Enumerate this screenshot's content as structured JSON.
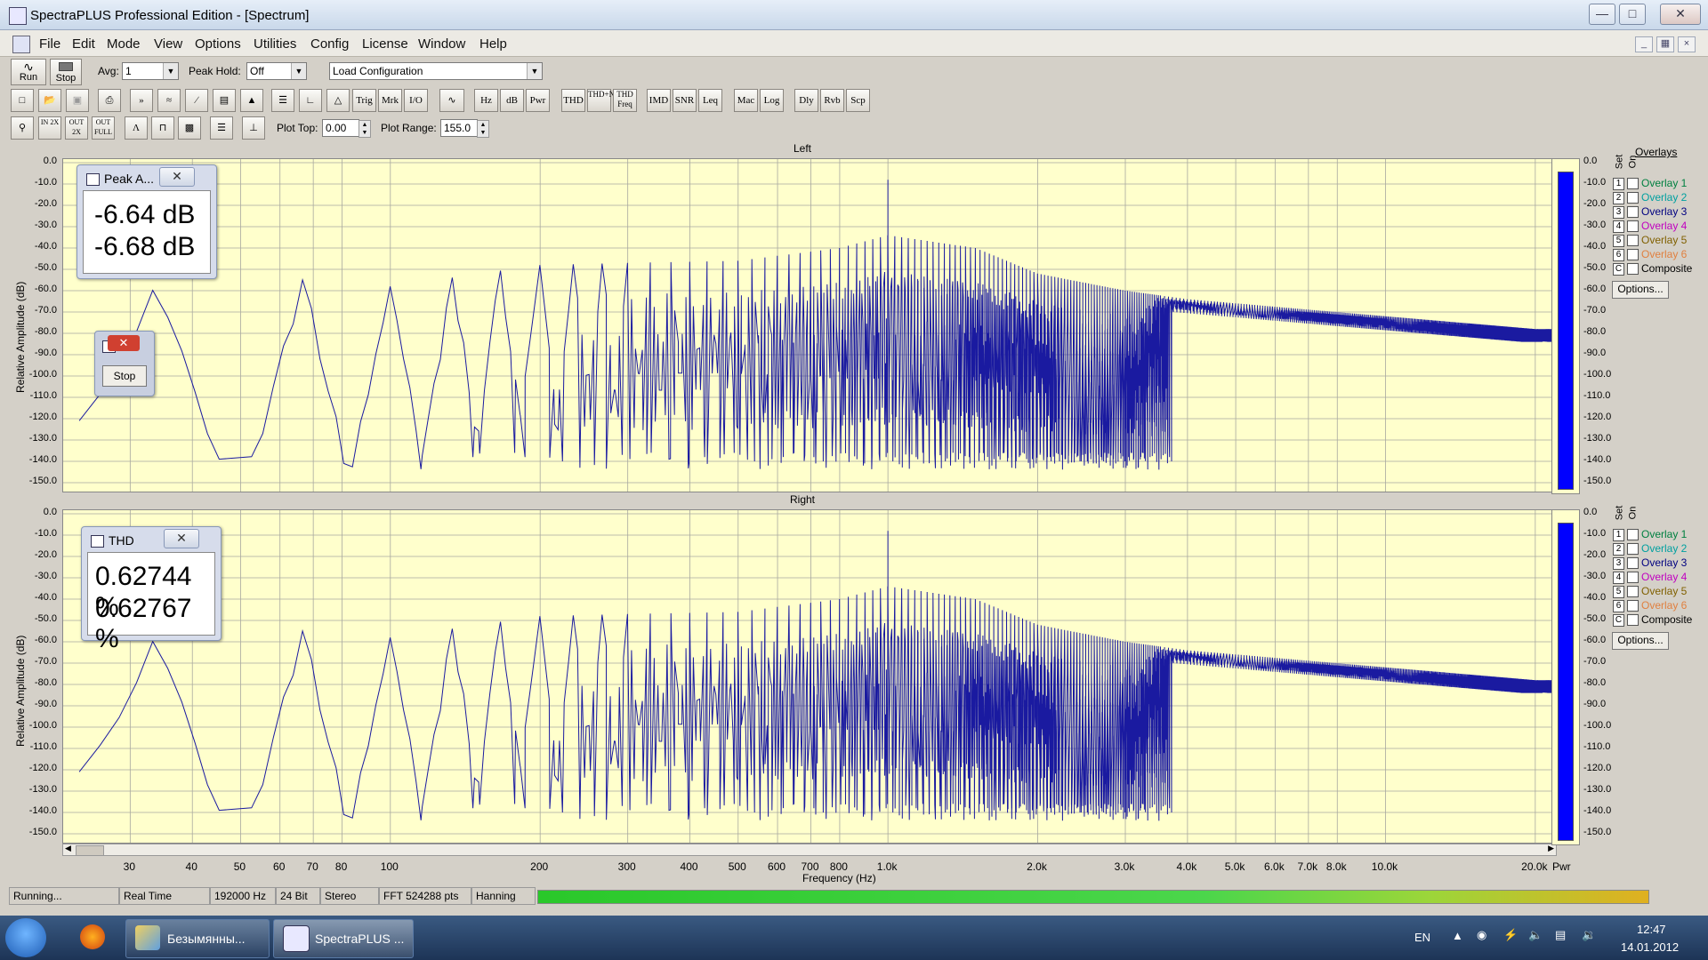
{
  "window": {
    "title": "SpectraPLUS Professional Edition - [Spectrum]"
  },
  "menu": [
    "File",
    "Edit",
    "Mode",
    "View",
    "Options",
    "Utilities",
    "Config",
    "License",
    "Window",
    "Help"
  ],
  "toolbar1": {
    "run_label": "Run",
    "stop_label": "Stop",
    "avg_label": "Avg:",
    "avg_value": "1",
    "peak_hold_label": "Peak Hold:",
    "peak_hold_value": "Off",
    "config_value": "Load Configuration"
  },
  "toolbar2": {
    "text_buttons": [
      "Trig",
      "Mrk",
      "I/O",
      "Hz",
      "dB",
      "Pwr",
      "THD",
      "THD+N",
      "THD Freq",
      "IMD",
      "SNR",
      "Leq",
      "Mac",
      "Log",
      "Dly",
      "Rvb",
      "Scp"
    ]
  },
  "toolbar3": {
    "zoom_buttons": [
      "IN 2X",
      "OUT 2X",
      "OUT FULL"
    ],
    "plot_top_label": "Plot Top:",
    "plot_top_value": "0.00",
    "plot_range_label": "Plot Range:",
    "plot_range_value": "155.0"
  },
  "plots": {
    "left_title": "Left",
    "right_title": "Right",
    "ylabel": "Relative Amplitude (dB)",
    "xlabel": "Frequency (Hz)",
    "yticks": [
      "0.0",
      "-10.0",
      "-20.0",
      "-30.0",
      "-40.0",
      "-50.0",
      "-60.0",
      "-70.0",
      "-80.0",
      "-90.0",
      "-100.0",
      "-110.0",
      "-120.0",
      "-130.0",
      "-140.0",
      "-150.0"
    ],
    "xticks": [
      "30",
      "40",
      "50",
      "60",
      "70",
      "80",
      "100",
      "200",
      "300",
      "400",
      "500",
      "600",
      "700",
      "800",
      "1.0k",
      "2.0k",
      "3.0k",
      "4.0k",
      "5.0k",
      "6.0k",
      "7.0k",
      "8.0k",
      "10.0k",
      "20.0k"
    ],
    "meter_label": "Pwr"
  },
  "chart_data": {
    "type": "line",
    "xlabel": "Frequency (Hz)",
    "ylabel": "Relative Amplitude (dB)",
    "x_scale": "log",
    "xlim": [
      22,
      22000
    ],
    "ylim": [
      -150,
      0
    ],
    "grid": true,
    "series": [
      {
        "name": "Left",
        "peaks": [
          [
            33,
            -60
          ],
          [
            50,
            -52
          ],
          [
            67,
            -55
          ],
          [
            83,
            -57
          ],
          [
            100,
            -58
          ],
          [
            200,
            -48
          ],
          [
            300,
            -47
          ],
          [
            500,
            -46
          ],
          [
            800,
            -40
          ],
          [
            1000,
            -34
          ],
          [
            1500,
            -40
          ],
          [
            2000,
            -52
          ],
          [
            3000,
            -60
          ],
          [
            4000,
            -64
          ],
          [
            10000,
            -72
          ],
          [
            20000,
            -78
          ]
        ],
        "noise_floor_db": -140
      },
      {
        "name": "Right",
        "peaks": [
          [
            33,
            -60
          ],
          [
            50,
            -52
          ],
          [
            67,
            -55
          ],
          [
            83,
            -57
          ],
          [
            100,
            -58
          ],
          [
            200,
            -48
          ],
          [
            300,
            -47
          ],
          [
            500,
            -46
          ],
          [
            800,
            -40
          ],
          [
            1000,
            -34
          ],
          [
            1500,
            -40
          ],
          [
            2000,
            -52
          ],
          [
            3000,
            -60
          ],
          [
            4000,
            -64
          ],
          [
            10000,
            -72
          ],
          [
            20000,
            -78
          ]
        ],
        "noise_floor_db": -140
      }
    ]
  },
  "overlays": {
    "set_label": "Set",
    "on_label": "On",
    "items": [
      {
        "num": "1",
        "name": "Overlay 1",
        "color": "#008040"
      },
      {
        "num": "2",
        "name": "Overlay 2",
        "color": "#00a0a0"
      },
      {
        "num": "3",
        "name": "Overlay 3",
        "color": "#000080"
      },
      {
        "num": "4",
        "name": "Overlay 4",
        "color": "#c000c0"
      },
      {
        "num": "5",
        "name": "Overlay 5",
        "color": "#806000"
      },
      {
        "num": "6",
        "name": "Overlay 6",
        "color": "#e08040"
      },
      {
        "num": "C",
        "name": "Composite",
        "color": "#000000"
      }
    ],
    "title": "Overlays",
    "options_label": "Options..."
  },
  "peak_window": {
    "title": "Peak A...",
    "value1": "-6.64 dB",
    "value2": "-6.68 dB"
  },
  "thd_window": {
    "title": "THD",
    "value1": "0.62744 %",
    "value2": "0.62767 %"
  },
  "stop_window": {
    "button": "Stop"
  },
  "status": {
    "cells": [
      "Running...",
      "Real Time",
      "192000 Hz",
      "24 Bit",
      "Stereo",
      "FFT 524288 pts",
      "Hanning"
    ]
  },
  "taskbar": {
    "items": [
      "Безымянны...",
      "SpectraPLUS ..."
    ],
    "lang": "EN",
    "time": "12:47",
    "date": "14.01.2012"
  }
}
